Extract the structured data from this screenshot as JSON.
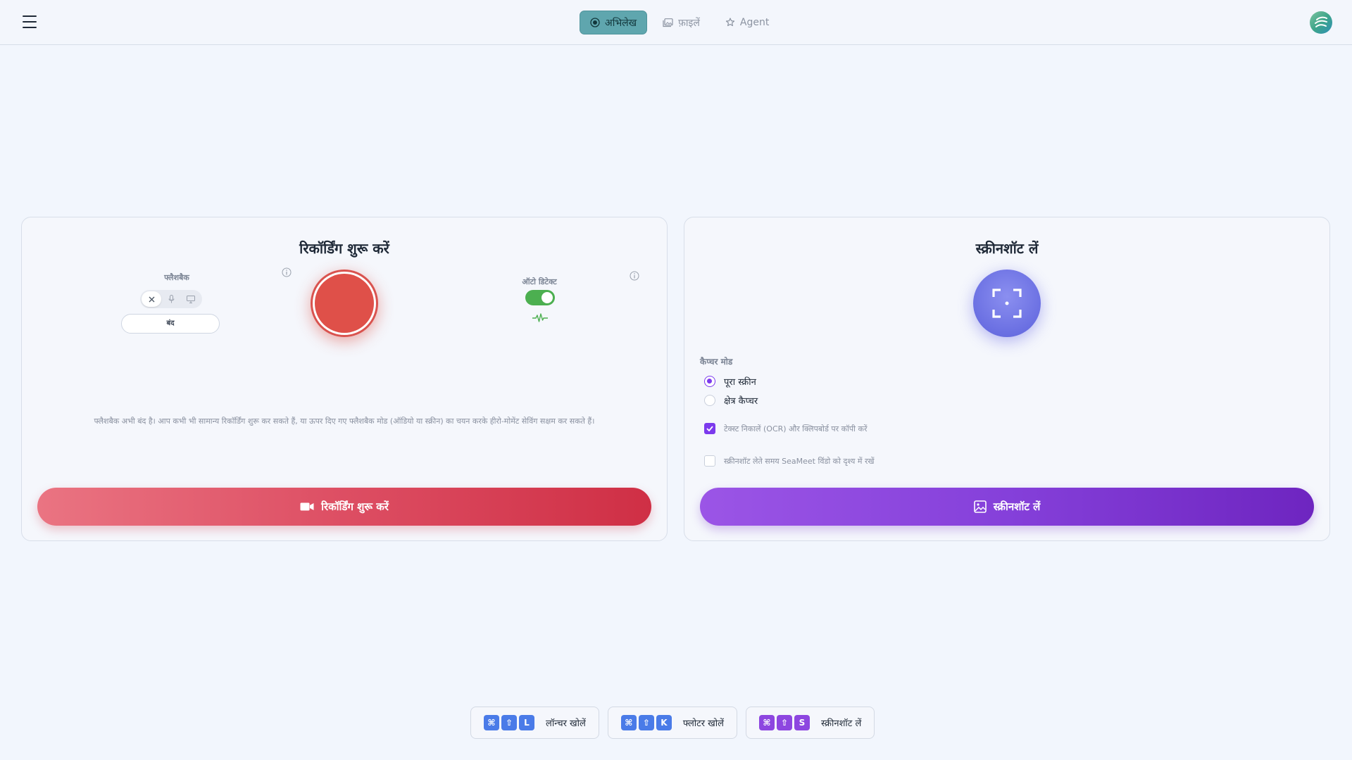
{
  "header": {
    "tabs": [
      {
        "label": "अभिलेख",
        "icon": "record-icon",
        "active": true
      },
      {
        "label": "फ़ाइलें",
        "icon": "gallery-icon",
        "active": false
      },
      {
        "label": "Agent",
        "icon": "bot-icon",
        "active": false
      }
    ]
  },
  "recording_card": {
    "title": "रिकॉर्डिंग शुरू करें",
    "flashback": {
      "label": "फ्लैशबैक",
      "options": [
        "off-icon",
        "mic-icon",
        "monitor-icon"
      ],
      "selected": "off-icon",
      "status": "बंद"
    },
    "audio_detect": {
      "label": "ऑटो डिटेक्ट",
      "enabled": true
    },
    "hint": "फ्लैशबैक अभी बंद है। आप कभी भी सामान्य रिकॉर्डिंग शुरू कर सकते हैं, या ऊपर दिए गए फ्लैशबैक मोड (ऑडियो या स्क्रीन) का चयन करके हीरो-मोमेंट सेविंग सक्षम कर सकते हैं।",
    "button_label": "रिकॉर्डिंग शुरू करें",
    "accent": "#df5049"
  },
  "screenshot_card": {
    "title": "स्क्रीनशॉट लें",
    "capture_mode_label": "कैप्चर मोड",
    "modes": [
      {
        "label": "पूरा स्क्रीन",
        "checked": true
      },
      {
        "label": "क्षेत्र कैप्चर",
        "checked": false
      }
    ],
    "options": [
      {
        "label": "टेक्स्ट निकालें (OCR) और क्लिपबोर्ड पर कॉपी करें",
        "checked": true
      },
      {
        "label": "स्क्रीनशॉट लेते समय SeaMeet विंडो को दृश्य में रखें",
        "checked": false
      }
    ],
    "button_label": "स्क्रीनशॉट लें",
    "accent": "#7c3aed"
  },
  "shortcuts": [
    {
      "keys": [
        "⌘",
        "⇧",
        "L"
      ],
      "label": "लॉन्चर खोलें",
      "color": "#4a7be8"
    },
    {
      "keys": [
        "⌘",
        "⇧",
        "K"
      ],
      "label": "फ्लोटर खोलें",
      "color": "#4a7be8"
    },
    {
      "keys": [
        "⌘",
        "⇧",
        "S"
      ],
      "label": "स्क्रीनशॉट लें",
      "color": "#8d46e0"
    }
  ]
}
